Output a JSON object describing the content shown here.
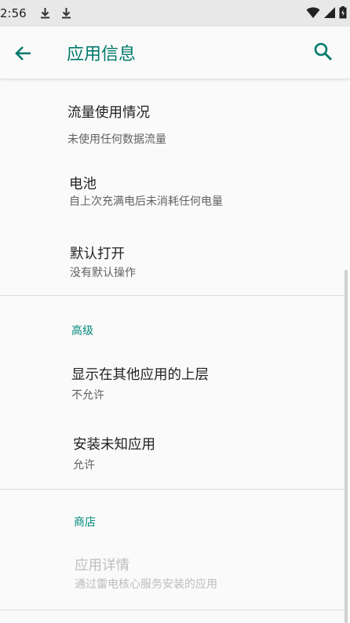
{
  "status_bar": {
    "time": "2:56",
    "icons": [
      "download-icon",
      "download-icon",
      "wifi-icon",
      "signal-icon",
      "battery-icon"
    ]
  },
  "app_bar": {
    "title": "应用信息",
    "back_icon": "arrow-back-icon",
    "search_icon": "search-icon"
  },
  "preferences": {
    "data_usage": {
      "title": "流量使用情况",
      "summary": "未使用任何数据流量"
    },
    "battery": {
      "title": "电池",
      "summary": "自上次充满电后未消耗任何电量"
    },
    "open_by_default": {
      "title": "默认打开",
      "summary": "没有默认操作"
    },
    "advanced_header": "高级",
    "display_over": {
      "title": "显示在其他应用的上层",
      "summary": "不允许"
    },
    "install_unknown": {
      "title": "安装未知应用",
      "summary": "允许"
    },
    "store_header": "商店",
    "app_details": {
      "title": "应用详情",
      "summary": "通过雷电核心服务安装的应用"
    }
  },
  "colors": {
    "accent": "#00796b",
    "section_header": "#00897b",
    "primary_text": "#212121",
    "secondary_text": "#616161",
    "disabled_text": "#bdbdbd"
  }
}
